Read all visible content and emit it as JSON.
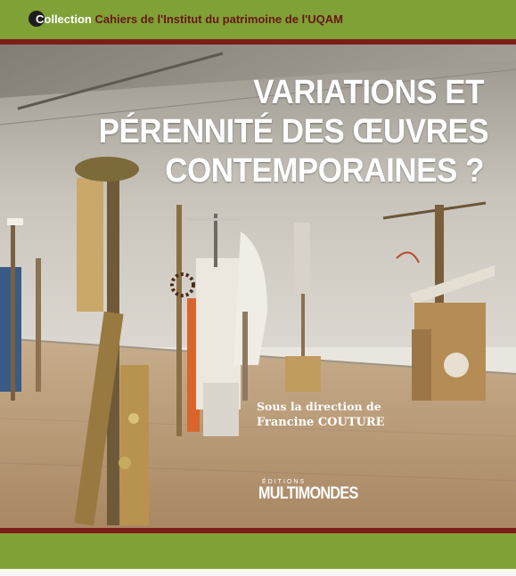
{
  "series": {
    "prefix_letter": "C",
    "prefix_rest": "ollection",
    "name": "Cahiers de l'Institut du patrimoine de l'UQAM"
  },
  "title": {
    "line1": "VARIATIONS ET",
    "line2": "PÉRENNITÉ DES ŒUVRES",
    "line3": "CONTEMPORAINES ?"
  },
  "direction": {
    "label": "Sous la direction de",
    "author": "Francine COUTURE"
  },
  "publisher": {
    "editions": "ÉDITIONS",
    "name_part1": "MULTI",
    "name_part2": "MONDES"
  },
  "colors": {
    "band_green": "#7fa136",
    "band_red": "#7e1d17",
    "title_white": "#ffffff"
  }
}
